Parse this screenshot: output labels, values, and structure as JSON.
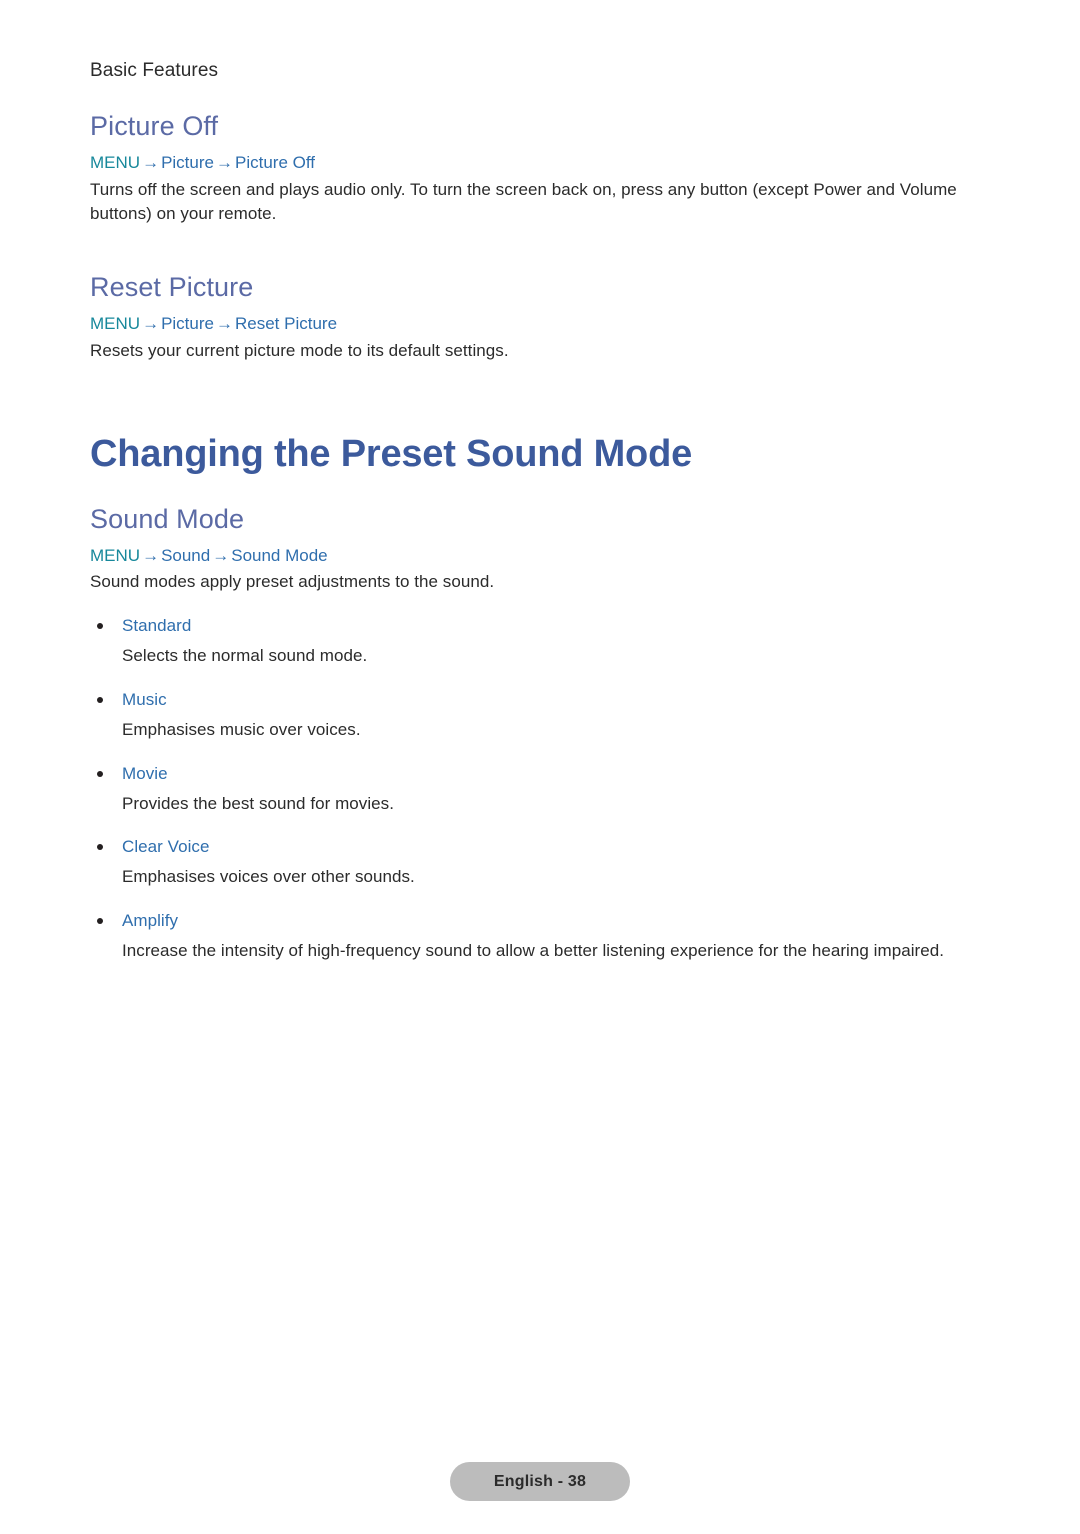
{
  "document": {
    "running_header": "Basic Features",
    "footer_label": "English - 38"
  },
  "colors": {
    "sub_heading": "#5b6aa5",
    "chapter_heading": "#3c5a9c",
    "menu_root": "#17889b",
    "menu_node": "#2f6ead",
    "body_text": "#2b2b2b",
    "bullet_label": "#2f6ead",
    "footer_pill_bg": "#bcbcbc",
    "page_bg": "#ffffff"
  },
  "arrow_glyph": "→",
  "sections": {
    "picture_off": {
      "heading": "Picture Off",
      "path": {
        "root": "MENU",
        "node1": "Picture",
        "node2": "Picture Off"
      },
      "body": "Turns off the screen and plays audio only. To turn the screen back on, press any button (except Power and Volume buttons) on your remote."
    },
    "reset_picture": {
      "heading": "Reset Picture",
      "path": {
        "root": "MENU",
        "node1": "Picture",
        "node2": "Reset Picture"
      },
      "body": "Resets your current picture mode to its default settings."
    },
    "chapter": {
      "heading": "Changing the Preset Sound Mode"
    },
    "sound_mode": {
      "heading": "Sound Mode",
      "path": {
        "root": "MENU",
        "node1": "Sound",
        "node2": "Sound Mode"
      },
      "body": "Sound modes apply preset adjustments to the sound.",
      "options": [
        {
          "label": "Standard",
          "description": "Selects the normal sound mode."
        },
        {
          "label": "Music",
          "description": "Emphasises music over voices."
        },
        {
          "label": "Movie",
          "description": "Provides the best sound for movies."
        },
        {
          "label": "Clear Voice",
          "description": "Emphasises voices over other sounds."
        },
        {
          "label": "Amplify",
          "description": "Increase the intensity of high-frequency sound to allow a better listening experience for the hearing impaired."
        }
      ]
    }
  }
}
